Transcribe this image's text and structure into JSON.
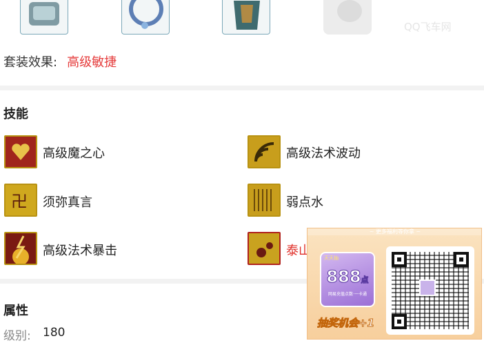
{
  "equipment": [
    {
      "icon": "armguard-icon"
    },
    {
      "icon": "ring-icon"
    },
    {
      "icon": "armor-icon"
    },
    {
      "icon": "empty-slot-icon"
    }
  ],
  "watermark": "QQ飞车网",
  "set_effect": {
    "label": "套装效果:",
    "value": "高级敏捷"
  },
  "skills": {
    "title": "技能",
    "items": [
      {
        "label": "高级魔之心",
        "icon": "heart-skill-icon"
      },
      {
        "label": "高级法术波动",
        "icon": "wave-skill-icon"
      },
      {
        "label": "须弥真言",
        "icon": "mantra-skill-icon"
      },
      {
        "label": "弱点水",
        "icon": "water-weakness-icon"
      },
      {
        "label": "高级法术暴击",
        "icon": "crit-skill-icon"
      },
      {
        "label": "泰山",
        "icon": "mountain-skill-icon",
        "highlight": true
      }
    ]
  },
  "attributes": {
    "title": "属性",
    "level_label": "级别:",
    "level_value": "180"
  },
  "promo": {
    "top_text": "~ 更多福利等你拿 ~",
    "card_corner": "天天抽",
    "card_amount": "888",
    "card_unit": "点",
    "card_sub": "网易充值点数·一卡通",
    "chance": "抽奖机会+1"
  },
  "colors": {
    "accent_red": "#e53a3a",
    "skill_gold": "#c9a21f"
  }
}
